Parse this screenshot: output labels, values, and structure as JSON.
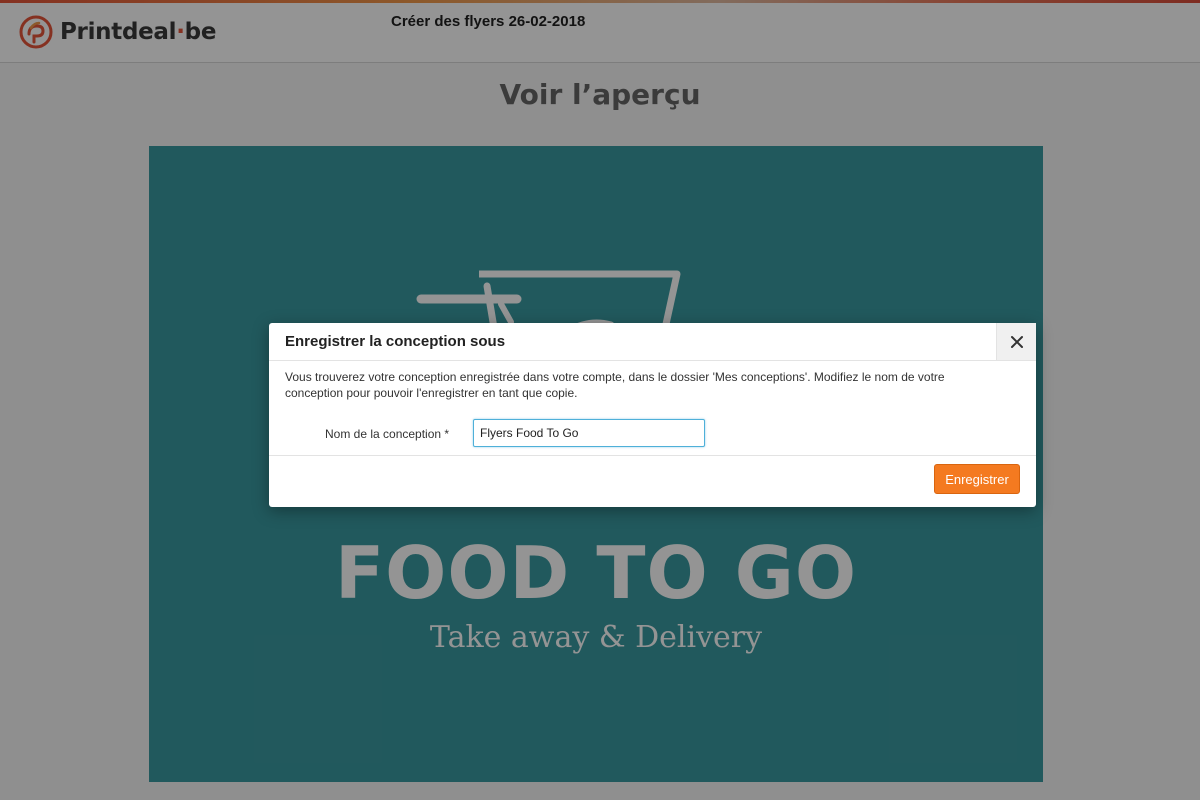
{
  "header": {
    "logo_text_main": "Printdeal",
    "logo_text_dot": "·",
    "logo_text_tld": "be",
    "title": "Créer des flyers 26-02-2018"
  },
  "page": {
    "preview_title": "Voir l’aperçu"
  },
  "flyer": {
    "heading": "FOOD TO GO",
    "subheading": "Take away & Delivery"
  },
  "modal": {
    "title": "Enregistrer la conception sous",
    "description": "Vous trouverez votre conception enregistrée dans votre compte, dans le dossier 'Mes conceptions'. Modifiez le nom de votre conception pour pouvoir l'enregistrer en tant que copie.",
    "field_label": "Nom de la conception *",
    "field_value": "Flyers Food To Go",
    "save_label": "Enregistrer"
  },
  "colors": {
    "accent": "#f47a20",
    "brand": "#e5553a",
    "flyer_bg": "#3a9aa0",
    "input_focus": "#4fb0d9"
  },
  "icons": {
    "logo": "printdeal-logo-icon",
    "close": "close-icon"
  }
}
